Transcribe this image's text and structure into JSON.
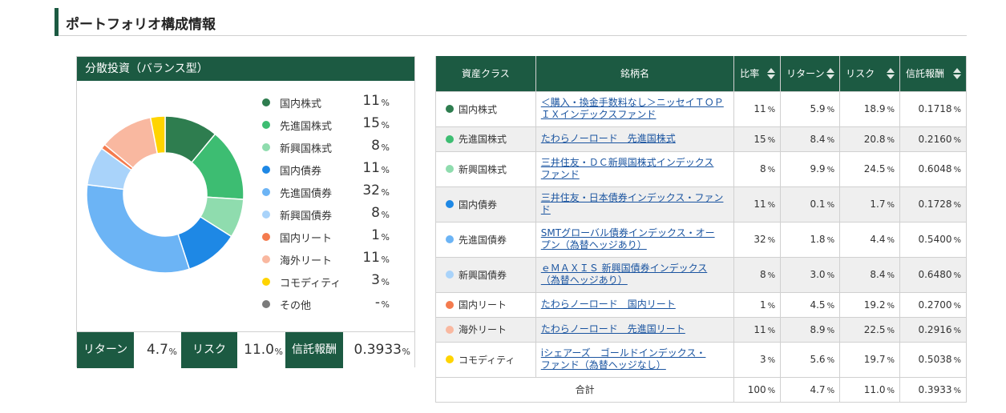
{
  "section_title": "ポートフォリオ構成情報",
  "panel": {
    "title": "分散投資（バランス型）",
    "legend": [
      {
        "label": "国内株式",
        "value": "11",
        "unit": "%",
        "color": "#2e7d4f",
        "share": 11
      },
      {
        "label": "先進国株式",
        "value": "15",
        "unit": "%",
        "color": "#3dbd72",
        "share": 15
      },
      {
        "label": "新興国株式",
        "value": "8",
        "unit": "%",
        "color": "#8fdcae",
        "share": 8
      },
      {
        "label": "国内債券",
        "value": "11",
        "unit": "%",
        "color": "#1e88e5",
        "share": 11
      },
      {
        "label": "先進国債券",
        "value": "32",
        "unit": "%",
        "color": "#6cb4f5",
        "share": 32
      },
      {
        "label": "新興国債券",
        "value": "8",
        "unit": "%",
        "color": "#a9d3fa",
        "share": 8
      },
      {
        "label": "国内リート",
        "value": "1",
        "unit": "%",
        "color": "#f47b4e",
        "share": 1
      },
      {
        "label": "海外リート",
        "value": "11",
        "unit": "%",
        "color": "#f9b8a0",
        "share": 11
      },
      {
        "label": "コモディティ",
        "value": "3",
        "unit": "%",
        "color": "#ffd400",
        "share": 3
      },
      {
        "label": "その他",
        "value": "-",
        "unit": "%",
        "color": "#7b7b7b",
        "share": 0
      }
    ],
    "summary": {
      "return_label": "リターン",
      "return_value": "4.7",
      "return_unit": "%",
      "risk_label": "リスク",
      "risk_value": "11.0",
      "risk_unit": "%",
      "fee_label": "信託報酬",
      "fee_value": "0.3933",
      "fee_unit": "%"
    }
  },
  "table": {
    "headers": {
      "asset_class": "資産クラス",
      "fund_name": "銘柄名",
      "ratio": "比率",
      "return": "リターン",
      "risk": "リスク",
      "fee": "信託報酬"
    },
    "rows": [
      {
        "asset_class": "国内株式",
        "color": "#2e7d4f",
        "fund_line1": "＜購入・換金手数料なし＞ニッセイＴＯＰ",
        "fund_line2": "ＩＸインデックスファンド",
        "ratio": "11",
        "return": "5.9",
        "risk": "18.9",
        "fee": "0.1718"
      },
      {
        "asset_class": "先進国株式",
        "color": "#3dbd72",
        "fund_line1": "たわらノーロード　先進国株式",
        "fund_line2": "",
        "ratio": "15",
        "return": "8.4",
        "risk": "20.8",
        "fee": "0.2160"
      },
      {
        "asset_class": "新興国株式",
        "color": "#8fdcae",
        "fund_line1": "三井住友・ＤＣ新興国株式インデックス",
        "fund_line2": "ファンド",
        "ratio": "8",
        "return": "9.9",
        "risk": "24.5",
        "fee": "0.6048"
      },
      {
        "asset_class": "国内債券",
        "color": "#1e88e5",
        "fund_line1": "三井住友・日本債券インデックス・ファン",
        "fund_line2": "ド",
        "ratio": "11",
        "return": "0.1",
        "risk": "1.7",
        "fee": "0.1728"
      },
      {
        "asset_class": "先進国債券",
        "color": "#6cb4f5",
        "fund_line1": "SMTグローバル債券インデックス・オー",
        "fund_line2": "プン（為替ヘッジあり）",
        "ratio": "32",
        "return": "1.8",
        "risk": "4.4",
        "fee": "0.5400"
      },
      {
        "asset_class": "新興国債券",
        "color": "#a9d3fa",
        "fund_line1": "ｅＭＡＸＩＳ 新興国債券インデックス",
        "fund_line2": "（為替ヘッジあり）",
        "ratio": "8",
        "return": "3.0",
        "risk": "8.4",
        "fee": "0.6480"
      },
      {
        "asset_class": "国内リート",
        "color": "#f47b4e",
        "fund_line1": "たわらノーロード　国内リート",
        "fund_line2": "",
        "ratio": "1",
        "return": "4.5",
        "risk": "19.2",
        "fee": "0.2700"
      },
      {
        "asset_class": "海外リート",
        "color": "#f9b8a0",
        "fund_line1": "たわらノーロード　先進国リート",
        "fund_line2": "",
        "ratio": "11",
        "return": "8.9",
        "risk": "22.5",
        "fee": "0.2916"
      },
      {
        "asset_class": "コモディティ",
        "color": "#ffd400",
        "fund_line1": "iシェアーズ　ゴールドインデックス・",
        "fund_line2": "ファンド（為替ヘッジなし）",
        "ratio": "3",
        "return": "5.6",
        "risk": "19.7",
        "fee": "0.5038"
      }
    ],
    "total": {
      "label": "合計",
      "ratio": "100",
      "return": "4.7",
      "risk": "11.0",
      "fee": "0.3933"
    },
    "unit": "%"
  }
}
